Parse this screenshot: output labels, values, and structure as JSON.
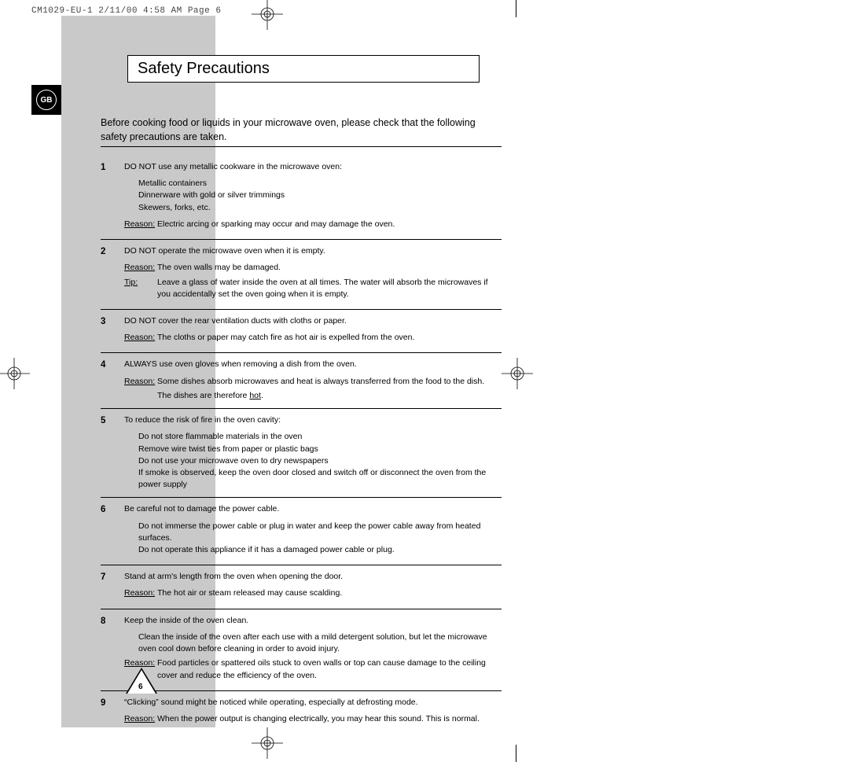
{
  "imprint": "CM1029-EU-1  2/11/00 4:58 AM  Page 6",
  "badge": "GB",
  "title": "Safety Precautions",
  "intro": "Before cooking food or liquids in your microwave oven, please check that the following safety precautions are taken.",
  "page_number": "6",
  "items": [
    {
      "num": "1",
      "lead": "DO NOT use any metallic cookware in the microwave oven:",
      "sublist": [
        "Metallic containers",
        "Dinnerware with gold or silver trimmings",
        "Skewers, forks, etc."
      ],
      "kv": [
        {
          "k": "Reason:",
          "v": "Electric arcing or sparking may occur and may damage the oven."
        }
      ]
    },
    {
      "num": "2",
      "lead": "DO NOT operate the microwave oven when it is empty.",
      "kv": [
        {
          "k": "Reason:",
          "v": "The oven walls may be damaged."
        },
        {
          "k": "Tip:",
          "v": "Leave a glass of water inside the oven at all times. The water will absorb the microwaves if you accidentally set the oven going when it is empty."
        }
      ]
    },
    {
      "num": "3",
      "lead": "DO NOT cover the rear ventilation ducts with cloths or paper.",
      "kv": [
        {
          "k": "Reason:",
          "v": "The cloths or paper may catch fire as hot air is expelled from the oven."
        }
      ]
    },
    {
      "num": "4",
      "lead": "ALWAYS use oven gloves when removing a dish from the oven.",
      "kv": [
        {
          "k": "Reason:",
          "v": "Some dishes absorb microwaves and heat is always transferred from the food to the dish."
        }
      ],
      "extra_html": "The dishes are therefore <span class='under'>hot</span>."
    },
    {
      "num": "5",
      "lead": "To reduce the risk of fire in the oven cavity:",
      "lines": [
        "Do not store flammable materials in the oven",
        "Remove wire twist ties from paper or plastic bags",
        "Do not use your microwave oven to dry newspapers",
        "If smoke is observed, keep the oven door closed and switch off or disconnect the oven from the power supply"
      ]
    },
    {
      "num": "6",
      "lead": "Be careful not to damage the power cable.",
      "lines2": [
        "Do not immerse the power cable or plug in water and keep the power cable away from heated surfaces.",
        "Do not operate this appliance if it has a damaged power cable or plug."
      ]
    },
    {
      "num": "7",
      "lead": "Stand at arm's length from the oven when opening the door.",
      "kv": [
        {
          "k": "Reason:",
          "v": "The hot air or steam released may cause scalding."
        }
      ]
    },
    {
      "num": "8",
      "lead": "Keep the inside of the oven clean.",
      "lines2": [
        "Clean the inside of the oven after each use with a mild detergent solution, but let the microwave oven cool down before cleaning in order to avoid injury."
      ],
      "kv": [
        {
          "k": "Reason:",
          "v": "Food particles or spattered oils stuck to oven walls or top can cause damage to the ceiling cover and reduce the efficiency of the oven."
        }
      ]
    },
    {
      "num": "9",
      "lead": "“Clicking” sound might be noticed while operating, especially at defrosting mode.",
      "kv": [
        {
          "k": "Reason:",
          "v": "When the power output is changing electrically, you may hear this sound. This is normal."
        }
      ]
    }
  ]
}
